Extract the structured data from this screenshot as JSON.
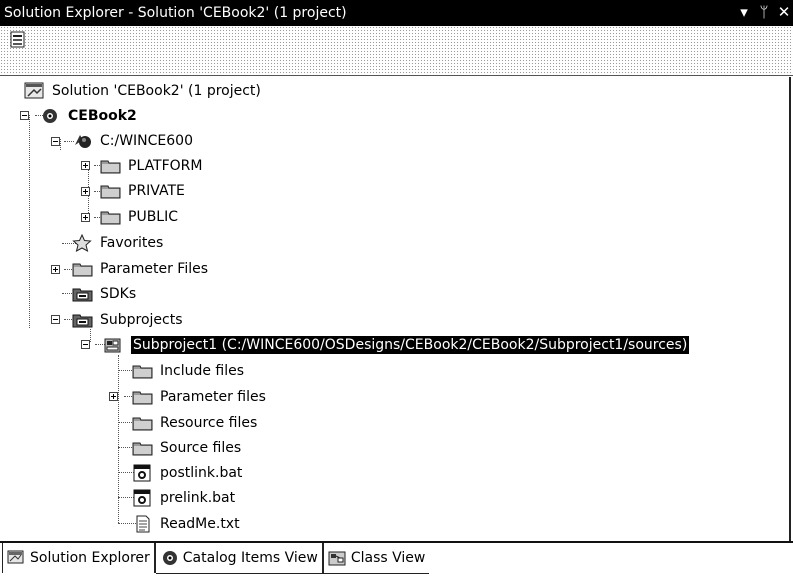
{
  "window": {
    "title": "Solution Explorer - Solution 'CEBook2' (1 project)",
    "controls": {
      "dropdown": "▾",
      "pin": "ᛘ",
      "close": "✕"
    }
  },
  "tree": {
    "items": [
      {
        "label": "Solution 'CEBook2' (1 project)",
        "icon": "solution-icon"
      },
      {
        "label": "CEBook2",
        "icon": "osdesign-icon"
      },
      {
        "label": "C:/WINCE600",
        "icon": "platform-root-icon"
      },
      {
        "label": "PLATFORM",
        "icon": "folder-icon"
      },
      {
        "label": "PRIVATE",
        "icon": "folder-icon"
      },
      {
        "label": "PUBLIC",
        "icon": "folder-icon"
      },
      {
        "label": "Favorites",
        "icon": "star-icon"
      },
      {
        "label": "Parameter Files",
        "icon": "folder-icon"
      },
      {
        "label": "SDKs",
        "icon": "sdk-folder-icon"
      },
      {
        "label": "Subprojects",
        "icon": "sdk-folder-icon"
      },
      {
        "label": "Subproject1 (C:/WINCE600/OSDesigns/CEBook2/CEBook2/Subproject1/sources)",
        "icon": "subproject-icon"
      },
      {
        "label": "Include files",
        "icon": "folder-icon"
      },
      {
        "label": "Parameter files",
        "icon": "folder-icon"
      },
      {
        "label": "Resource files",
        "icon": "folder-icon"
      },
      {
        "label": "Source files",
        "icon": "folder-icon"
      },
      {
        "label": "postlink.bat",
        "icon": "batch-file-icon"
      },
      {
        "label": "prelink.bat",
        "icon": "batch-file-icon"
      },
      {
        "label": "ReadMe.txt",
        "icon": "text-file-icon"
      }
    ]
  },
  "bottom_tabs": [
    {
      "label": "Solution Explorer",
      "icon": "solution-explorer-icon"
    },
    {
      "label": "Catalog Items View",
      "icon": "catalog-icon"
    },
    {
      "label": "Class View",
      "icon": "class-view-icon"
    }
  ]
}
